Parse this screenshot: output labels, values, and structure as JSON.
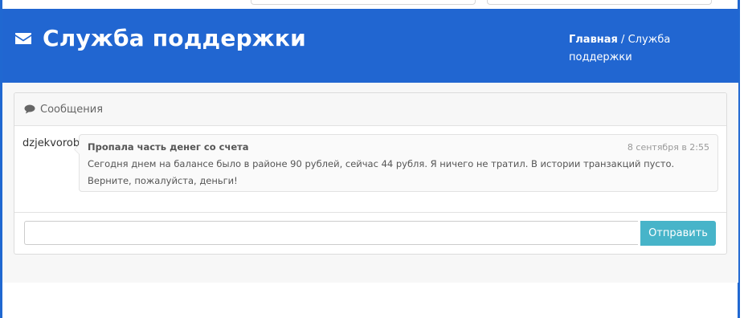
{
  "header": {
    "title": "Служба поддержки",
    "icon": "envelope-icon",
    "background_color": "#2166d1"
  },
  "breadcrumb": {
    "home": "Главная",
    "separator": " / ",
    "current": "Служба поддержки"
  },
  "panel": {
    "heading": "Сообщения",
    "heading_icon": "comments-icon"
  },
  "messages": [
    {
      "user": "dzjekvorobev",
      "subject": "Пропала часть денег со счета",
      "time": "8 сентября в 2:55",
      "body": "Сегодня днем на балансе было в районе 90 рублей, сейчас 44 рубля. Я ничего не тратил. В истории транзакций пусто. Верните, пожалуйста, деньги!"
    }
  ],
  "reply": {
    "value": "",
    "button_label": "Отправить",
    "button_color": "#47b4c9"
  }
}
